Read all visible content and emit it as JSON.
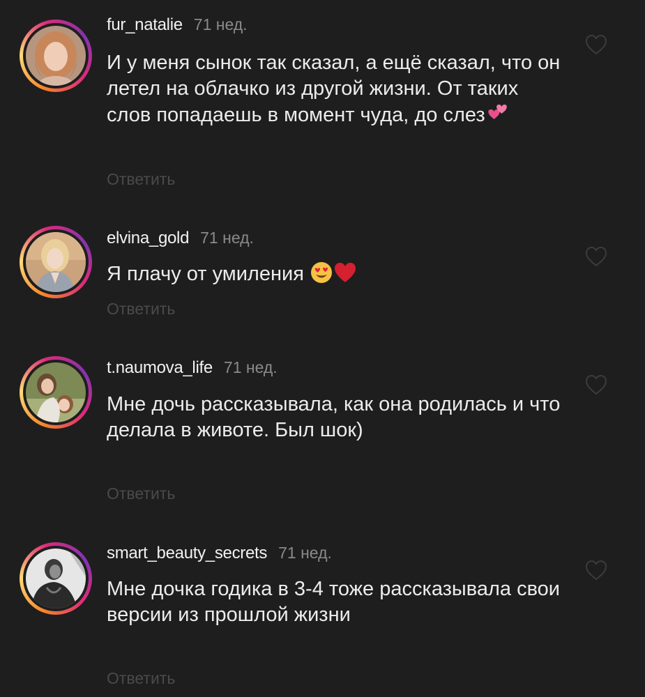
{
  "comments": [
    {
      "username": "fur_natalie",
      "time": "71 нед.",
      "text": "И у меня сынок так сказал, а ещё сказал, что он летел на облачко из другой жизни. От таких слов попадаешь в момент чуда, до слез",
      "emojis": [
        "two-hearts"
      ],
      "reply_label": "Ответить"
    },
    {
      "username": "elvina_gold",
      "time": "71 нед.",
      "text": "Я плачу от умиления ",
      "emojis": [
        "heart-eyes-face",
        "red-heart"
      ],
      "reply_label": "Ответить"
    },
    {
      "username": "t.naumova_life",
      "time": "71 нед.",
      "text": "Мне дочь рассказывала, как она родилась и что делала в животе. Был шок)",
      "emojis": [],
      "reply_label": "Ответить"
    },
    {
      "username": "smart_beauty_secrets",
      "time": "71 нед.",
      "text": "Мне дочка годика в 3-4 тоже рассказывала свои версии из прошлой жизни",
      "emojis": [],
      "reply_label": "Ответить"
    }
  ],
  "icons": {
    "like": "heart-outline-icon"
  },
  "colors": {
    "background": "#1e1e1e",
    "ring_gradient": [
      "#f58529",
      "#feda77",
      "#dd2a7b",
      "#8134af"
    ],
    "reply": "#4a4a4a",
    "time": "#8a8a8a"
  }
}
